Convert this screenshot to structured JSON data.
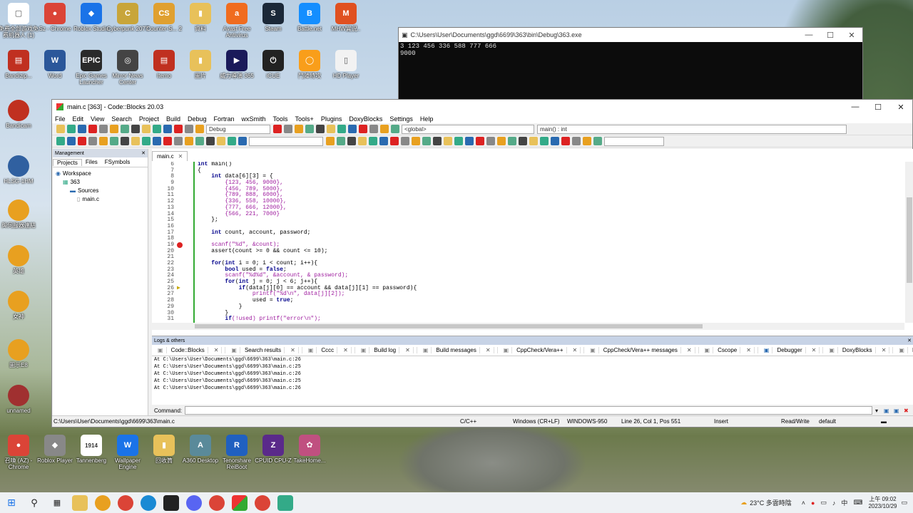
{
  "desktop_icons": [
    {
      "label": "免费全部游戏免费机器人 (1)",
      "color": "#ffffff",
      "glyph": "▢"
    },
    {
      "label": "Sz - Chrome",
      "color": "#db4437",
      "glyph": "●"
    },
    {
      "label": "Roblox Studio",
      "color": "#1a73e8",
      "glyph": "◆"
    },
    {
      "label": "Cyberpunk 2077",
      "color": "#c8a53a",
      "glyph": "C"
    },
    {
      "label": "Counter-S... 2",
      "color": "#e0a030",
      "glyph": "CS"
    },
    {
      "label": "資料",
      "color": "#e8c15a",
      "glyph": "▮"
    },
    {
      "label": "Avast Free Antivirus",
      "color": "#f06c1f",
      "glyph": "a"
    },
    {
      "label": "Steam",
      "color": "#1b2838",
      "glyph": "S"
    },
    {
      "label": "Battle.net",
      "color": "#148eff",
      "glyph": "B"
    },
    {
      "label": "MHW實況..",
      "color": "#e05020",
      "glyph": "M"
    },
    {
      "label": "Bandizip...",
      "color": "#c03020",
      "glyph": "▤"
    },
    {
      "label": "Word",
      "color": "#2b579a",
      "glyph": "W"
    },
    {
      "label": "Epic Games Launcher",
      "color": "#2a2a2a",
      "glyph": "EPIC"
    },
    {
      "label": "Mirror News Center",
      "color": "#444444",
      "glyph": "◎"
    },
    {
      "label": "Itemo",
      "color": "#c03020",
      "glyph": "▤"
    },
    {
      "label": "圖片",
      "color": "#e8c15a",
      "glyph": "▮"
    },
    {
      "label": "威力導演 365",
      "color": "#1a1a5a",
      "glyph": "▶"
    },
    {
      "label": "iCUE",
      "color": "#222222",
      "glyph": "⏻"
    },
    {
      "label": "鬥陣特攻",
      "color": "#f99e1a",
      "glyph": "◯"
    },
    {
      "label": "HD Player",
      "color": "#f2f2f2",
      "glyph": "▯"
    }
  ],
  "console": {
    "title": "C:\\Users\\User\\Documents\\ggd\\6699\\363\\bin\\Debug\\363.exe",
    "output": "3 123 456 336 588 777 666\n9000"
  },
  "ide": {
    "title": "main.c [363] - Code::Blocks 20.03",
    "menu": [
      "File",
      "Edit",
      "View",
      "Search",
      "Project",
      "Build",
      "Debug",
      "Fortran",
      "wxSmith",
      "Tools",
      "Tools+",
      "Plugins",
      "DoxyBlocks",
      "Settings",
      "Help"
    ],
    "build_target": "Debug",
    "scope_select": "<global>",
    "func_select": "main() : int",
    "management": {
      "header": "Management",
      "tabs": [
        "Projects",
        "Files",
        "FSymbols"
      ],
      "tree": [
        {
          "label": "Workspace",
          "indent": 0
        },
        {
          "label": "363",
          "indent": 1
        },
        {
          "label": "Sources",
          "indent": 2
        },
        {
          "label": "main.c",
          "indent": 3
        }
      ]
    },
    "editor_tab": "main.c",
    "code_lines": [
      {
        "n": "6",
        "t": "int main()"
      },
      {
        "n": "7",
        "t": "{"
      },
      {
        "n": "8",
        "t": "    int data[6][3] = {"
      },
      {
        "n": "9",
        "t": "        {123, 456, 9000},"
      },
      {
        "n": "10",
        "t": "        {456, 789, 5000},"
      },
      {
        "n": "11",
        "t": "        {789, 888, 6000},"
      },
      {
        "n": "12",
        "t": "        {336, 558, 10000},"
      },
      {
        "n": "13",
        "t": "        {777, 666, 12000},"
      },
      {
        "n": "14",
        "t": "        {566, 221, 7000}"
      },
      {
        "n": "15",
        "t": "    };"
      },
      {
        "n": "16",
        "t": ""
      },
      {
        "n": "17",
        "t": "    int count, account, password;"
      },
      {
        "n": "18",
        "t": ""
      },
      {
        "n": "19",
        "t": "    scanf(\"%d\", &count);",
        "bp": true
      },
      {
        "n": "20",
        "t": "    assert(count >= 0 && count <= 10);"
      },
      {
        "n": "21",
        "t": ""
      },
      {
        "n": "22",
        "t": "    for(int i = 0; i < count; i++){"
      },
      {
        "n": "23",
        "t": "        bool used = false;"
      },
      {
        "n": "24",
        "t": "        scanf(\"%d%d\", &account, & password);"
      },
      {
        "n": "25",
        "t": "        for(int j = 0; j < 6; j++){"
      },
      {
        "n": "26",
        "t": "            if(data[j][0] == account && data[j][1] == password){"
      },
      {
        "n": "27",
        "t": "                printf(\"%d\\n\", data[j][2]);"
      },
      {
        "n": "28",
        "t": "                used = true;"
      },
      {
        "n": "29",
        "t": "            }"
      },
      {
        "n": "30",
        "t": "        }"
      },
      {
        "n": "31",
        "t": "        if(!used) printf(\"error\\n\");"
      }
    ],
    "logs": {
      "header": "Logs & others",
      "tabs": [
        "Code::Blocks",
        "Search results",
        "Cccc",
        "Build log",
        "Build messages",
        "CppCheck/Vera++",
        "CppCheck/Vera++ messages",
        "Cscope",
        "Debugger",
        "DoxyBlocks",
        "Fortran info",
        "Closed files list",
        "Thread sear"
      ],
      "lines": [
        "At C:\\Users\\User\\Documents\\ggd\\6699\\363\\main.c:26",
        "At C:\\Users\\User\\Documents\\ggd\\6699\\363\\main.c:25",
        "At C:\\Users\\User\\Documents\\ggd\\6699\\363\\main.c:26",
        "At C:\\Users\\User\\Documents\\ggd\\6699\\363\\main.c:25",
        "At C:\\Users\\User\\Documents\\ggd\\6699\\363\\main.c:26"
      ],
      "command_label": "Command:"
    },
    "status": {
      "path": "C:\\Users\\User\\Documents\\ggd\\6699\\363\\main.c",
      "lang": "C/C++",
      "eol": "Windows (CR+LF)",
      "encoding": "WINDOWS-950",
      "position": "Line 26, Col 1, Pos 551",
      "mode": "Insert",
      "access": "Read/Write",
      "profile": "default"
    }
  },
  "left_icons": [
    {
      "label": "Bandicam",
      "color": "#c03020"
    },
    {
      "label": "HLSG-1HM",
      "color": "#3060a0"
    },
    {
      "label": "與伺服器連結",
      "color": "#e8a020"
    },
    {
      "label": "英雄",
      "color": "#e8a020"
    },
    {
      "label": "女神",
      "color": "#e8a020"
    },
    {
      "label": "圖示E8",
      "color": "#e8a020"
    },
    {
      "label": "unnamed",
      "color": "#a03030"
    }
  ],
  "bottom_icons": [
    {
      "label": "召喚 (AZ) - Chrome",
      "color": "#db4437",
      "glyph": "●"
    },
    {
      "label": "Roblox Player",
      "color": "#888888",
      "glyph": "◆"
    },
    {
      "label": "Tannenberg",
      "color": "#ffffff",
      "glyph": "1914"
    },
    {
      "label": "Wallpaper Engine",
      "color": "#1a73e8",
      "glyph": "W"
    },
    {
      "label": "回收筒",
      "color": "#e8c15a",
      "glyph": "▮"
    },
    {
      "label": "A360 Desktop",
      "color": "#5a8a9a",
      "glyph": "A"
    },
    {
      "label": "Tenorshare ReiBoot",
      "color": "#2060c0",
      "glyph": "R"
    },
    {
      "label": "CPUID CPU-Z",
      "color": "#5a2a8a",
      "glyph": "Z"
    },
    {
      "label": "TakeHome...",
      "color": "#c05080",
      "glyph": "✿"
    }
  ],
  "taskbar": {
    "weather": "23°C 多雲時陰",
    "ime": "中",
    "time": "上午 09:02",
    "date": "2023/10/29"
  }
}
